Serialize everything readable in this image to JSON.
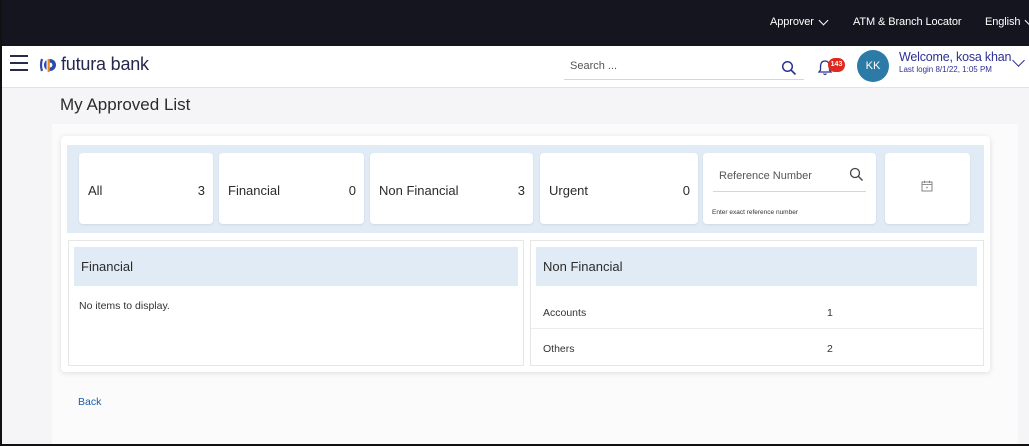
{
  "topbar": {
    "role_menu": "Approver",
    "atm_branch_locator": "ATM & Branch Locator",
    "language": "English"
  },
  "header": {
    "logo_text": "futura bank",
    "search_placeholder": "Search ...",
    "notification_count": "143",
    "avatar_initials": "KK",
    "welcome_text": "Welcome, kosa khan",
    "last_login": "Last login 8/1/22, 1:05 PM"
  },
  "page": {
    "title": "My Approved List"
  },
  "filters": [
    {
      "label": "All",
      "count": "3"
    },
    {
      "label": "Financial",
      "count": "0"
    },
    {
      "label": "Non Financial",
      "count": "3"
    },
    {
      "label": "Urgent",
      "count": "0"
    }
  ],
  "reference_search": {
    "placeholder": "Reference Number",
    "hint": "Enter exact reference number"
  },
  "financial_panel": {
    "title": "Financial",
    "empty_message": "No items to display."
  },
  "non_financial_panel": {
    "title": "Non Financial",
    "rows": [
      {
        "label": "Accounts",
        "value": "1"
      },
      {
        "label": "Others",
        "value": "2"
      }
    ]
  },
  "footer": {
    "back_label": "Back"
  },
  "colors": {
    "topbar_bg": "#15151f",
    "accent_blue": "#2d3192",
    "panel_header_bg": "#e1ebf5",
    "avatar_bg": "#2b7ba6",
    "badge_red": "#e0281d",
    "link_blue": "#1b5ea8"
  }
}
